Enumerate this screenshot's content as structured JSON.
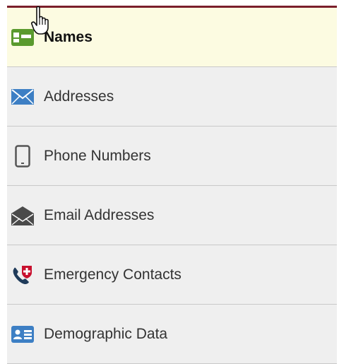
{
  "nav": {
    "items": [
      {
        "label": "Names",
        "icon": "name-card-icon",
        "selected": true,
        "icon_color": "#5a9a2e"
      },
      {
        "label": "Addresses",
        "icon": "envelope-icon",
        "selected": false,
        "icon_color": "#3d7fc4"
      },
      {
        "label": "Phone Numbers",
        "icon": "phone-icon",
        "selected": false,
        "icon_color": "#555555"
      },
      {
        "label": "Email Addresses",
        "icon": "open-envelope-icon",
        "selected": false,
        "icon_color": "#4a4a4a"
      },
      {
        "label": "Emergency Contacts",
        "icon": "emergency-phone-icon",
        "selected": false,
        "icon_color": "#c8102e"
      },
      {
        "label": "Demographic Data",
        "icon": "id-card-icon",
        "selected": false,
        "icon_color": "#3d7fc4"
      }
    ]
  },
  "colors": {
    "top_border": "#7a1f2b",
    "selected_bg": "#fcfbe1",
    "item_bg": "#efefef",
    "divider": "#c9c9c9"
  },
  "cursor": "hand-pointer-icon"
}
